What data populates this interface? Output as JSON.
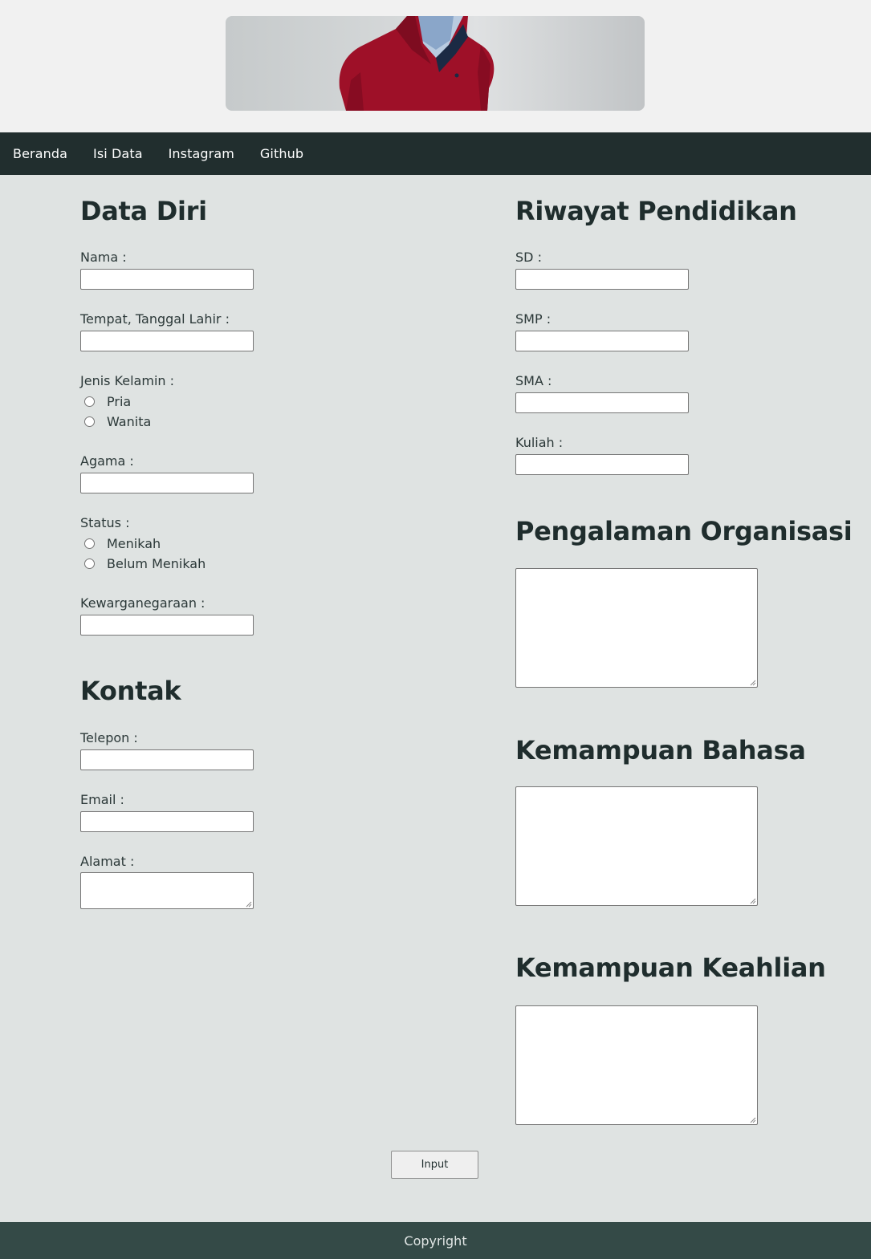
{
  "nav": {
    "items": [
      "Beranda",
      "Isi Data",
      "Instagram",
      "Github"
    ]
  },
  "data_diri": {
    "title": "Data Diri",
    "nama_label": "Nama :",
    "ttl_label": "Tempat, Tanggal Lahir :",
    "jenis_kelamin_label": "Jenis Kelamin :",
    "jenis_kelamin_options": [
      "Pria",
      "Wanita"
    ],
    "agama_label": "Agama :",
    "status_label": "Status :",
    "status_options": [
      "Menikah",
      "Belum Menikah"
    ],
    "kewarganegaraan_label": "Kewarganegaraan :"
  },
  "kontak": {
    "title": "Kontak",
    "telepon_label": "Telepon :",
    "email_label": "Email :",
    "alamat_label": "Alamat :"
  },
  "pendidikan": {
    "title": "Riwayat Pendidikan",
    "sd_label": "SD :",
    "smp_label": "SMP :",
    "sma_label": "SMA :",
    "kuliah_label": "Kuliah :"
  },
  "organisasi": {
    "title": "Pengalaman Organisasi"
  },
  "bahasa": {
    "title": "Kemampuan Bahasa"
  },
  "keahlian": {
    "title": "Kemampuan Keahlian"
  },
  "form": {
    "submit_label": "Input"
  },
  "footer": {
    "text": "Copyright"
  },
  "colors": {
    "navbar": "#212e2e",
    "main_bg": "#dfe3e2",
    "footer": "#344a47",
    "jacket": "#9e1028"
  }
}
